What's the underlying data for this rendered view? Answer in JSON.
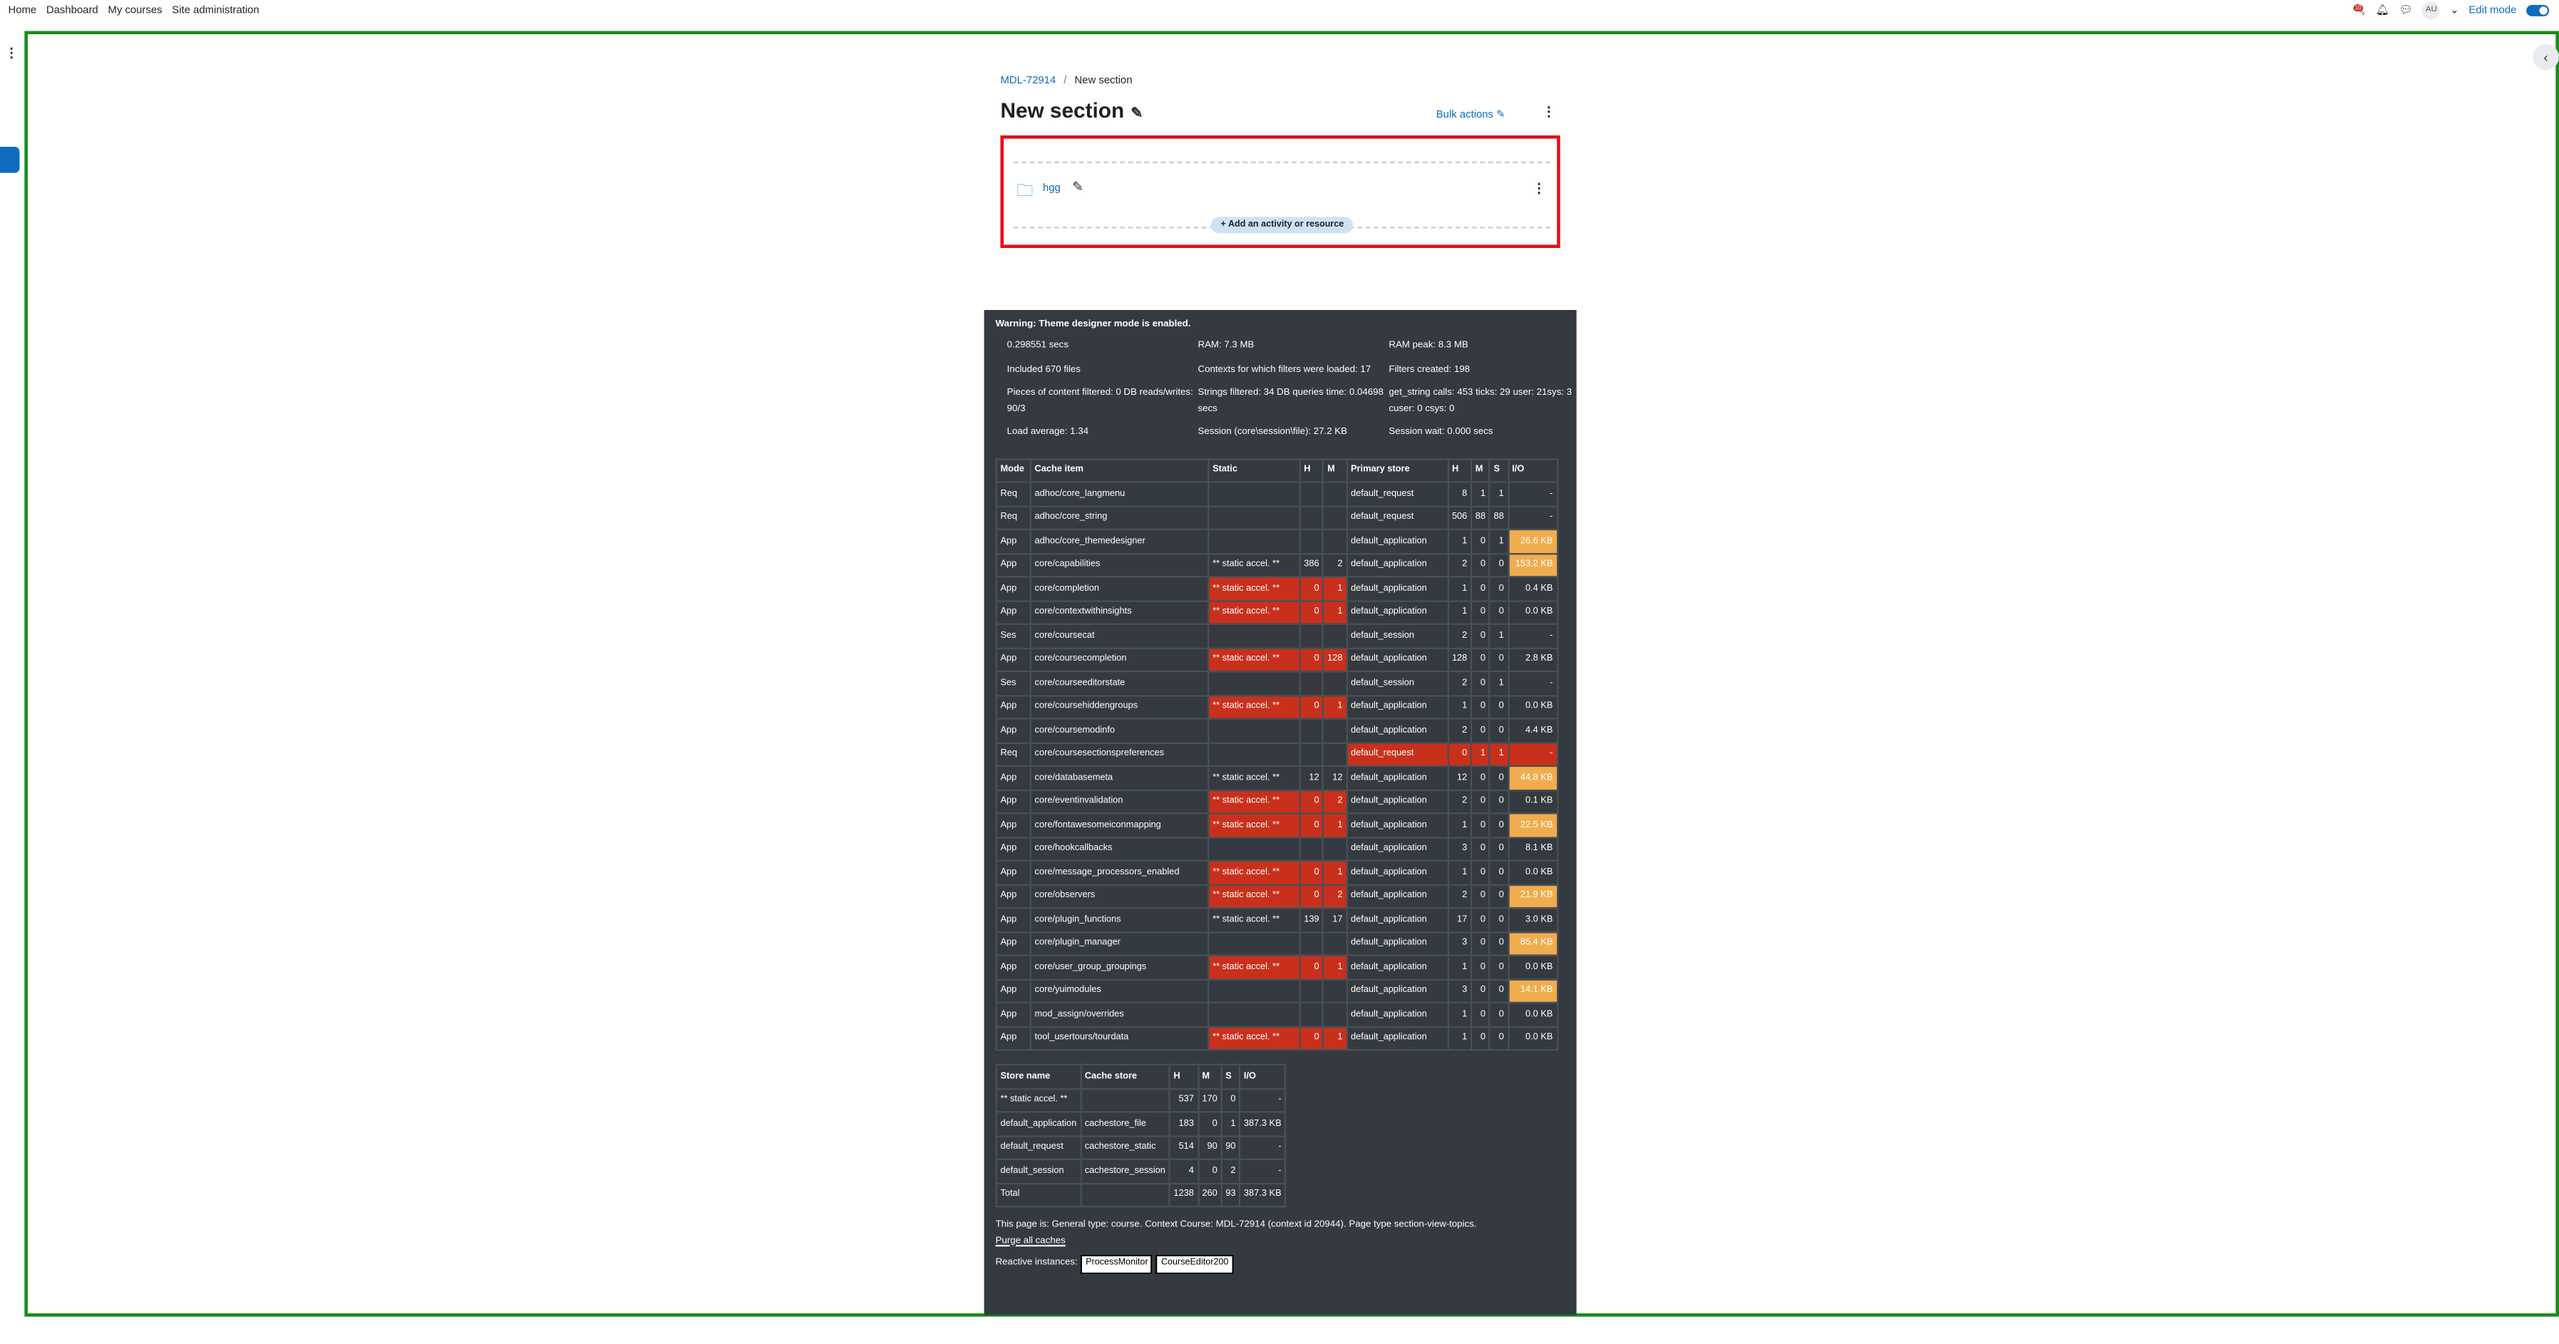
{
  "topnav": {
    "items": [
      "Home",
      "Dashboard",
      "My courses",
      "Site administration"
    ],
    "badge": "10",
    "avatar": "AU",
    "edit_mode": "Edit mode"
  },
  "breadcrumb": {
    "course": "MDL-72914",
    "sep": "/",
    "current": "New section"
  },
  "page": {
    "title": "New section",
    "bulk": "Bulk actions"
  },
  "activity": {
    "name": "hgg",
    "add": "Add an activity or resource"
  },
  "perf": {
    "warning": "Warning: Theme designer mode is enabled.",
    "stats": [
      "0.298551 secs",
      "RAM: 7.3 MB",
      "RAM peak: 8.3 MB",
      "Included 670 files",
      "Contexts for which filters were loaded: 17",
      "Filters created: 198",
      "Pieces of content filtered: 0 DB reads/writes: 90/3",
      "Strings filtered: 34 DB queries time: 0.04698 secs",
      "get_string calls: 453 ticks: 29 user: 21sys: 3 cuser: 0 csys: 0",
      "Load average: 1.34",
      "Session (core\\session\\file): 27.2 KB",
      "Session wait: 0.000 secs"
    ],
    "cache_headers": [
      "Mode",
      "Cache item",
      "Static",
      "H",
      "M",
      "Primary store",
      "H",
      "M",
      "S",
      "I/O"
    ],
    "cache_rows": [
      [
        "Req",
        "adhoc/core_langmenu",
        "",
        "",
        "",
        "default_request",
        "8",
        "1",
        "1",
        "-"
      ],
      [
        "Req",
        "adhoc/core_string",
        "",
        "",
        "",
        "default_request",
        "506",
        "88",
        "88",
        "-"
      ],
      [
        "App",
        "adhoc/core_themedesigner",
        "",
        "",
        "",
        "default_application",
        "1",
        "0",
        "1",
        "26.6 KB"
      ],
      [
        "App",
        "core/capabilities",
        "** static accel. **",
        "386",
        "2",
        "default_application",
        "2",
        "0",
        "0",
        "153.2 KB"
      ],
      [
        "App",
        "core/completion",
        "** static accel. **",
        "0",
        "1",
        "default_application",
        "1",
        "0",
        "0",
        "0.4 KB"
      ],
      [
        "App",
        "core/contextwithinsights",
        "** static accel. **",
        "0",
        "1",
        "default_application",
        "1",
        "0",
        "0",
        "0.0 KB"
      ],
      [
        "Ses",
        "core/coursecat",
        "",
        "",
        "",
        "default_session",
        "2",
        "0",
        "1",
        "-"
      ],
      [
        "App",
        "core/coursecompletion",
        "** static accel. **",
        "0",
        "128",
        "default_application",
        "128",
        "0",
        "0",
        "2.8 KB"
      ],
      [
        "Ses",
        "core/courseeditorstate",
        "",
        "",
        "",
        "default_session",
        "2",
        "0",
        "1",
        "-"
      ],
      [
        "App",
        "core/coursehiddengroups",
        "** static accel. **",
        "0",
        "1",
        "default_application",
        "1",
        "0",
        "0",
        "0.0 KB"
      ],
      [
        "App",
        "core/coursemodinfo",
        "",
        "",
        "",
        "default_application",
        "2",
        "0",
        "0",
        "4.4 KB"
      ],
      [
        "Req",
        "core/coursesectionspreferences",
        "",
        "",
        "",
        "default_request",
        "0",
        "1",
        "1",
        "-"
      ],
      [
        "App",
        "core/databasemeta",
        "** static accel. **",
        "12",
        "12",
        "default_application",
        "12",
        "0",
        "0",
        "44.8 KB"
      ],
      [
        "App",
        "core/eventinvalidation",
        "** static accel. **",
        "0",
        "2",
        "default_application",
        "2",
        "0",
        "0",
        "0.1 KB"
      ],
      [
        "App",
        "core/fontawesomeiconmapping",
        "** static accel. **",
        "0",
        "1",
        "default_application",
        "1",
        "0",
        "0",
        "22.5 KB"
      ],
      [
        "App",
        "core/hookcallbacks",
        "",
        "",
        "",
        "default_application",
        "3",
        "0",
        "0",
        "8.1 KB"
      ],
      [
        "App",
        "core/message_processors_enabled",
        "** static accel. **",
        "0",
        "1",
        "default_application",
        "1",
        "0",
        "0",
        "0.0 KB"
      ],
      [
        "App",
        "core/observers",
        "** static accel. **",
        "0",
        "2",
        "default_application",
        "2",
        "0",
        "0",
        "21.9 KB"
      ],
      [
        "App",
        "core/plugin_functions",
        "** static accel. **",
        "139",
        "17",
        "default_application",
        "17",
        "0",
        "0",
        "3.0 KB"
      ],
      [
        "App",
        "core/plugin_manager",
        "",
        "",
        "",
        "default_application",
        "3",
        "0",
        "0",
        "85.4 KB"
      ],
      [
        "App",
        "core/user_group_groupings",
        "** static accel. **",
        "0",
        "1",
        "default_application",
        "1",
        "0",
        "0",
        "0.0 KB"
      ],
      [
        "App",
        "core/yuimodules",
        "",
        "",
        "",
        "default_application",
        "3",
        "0",
        "0",
        "14.1 KB"
      ],
      [
        "App",
        "mod_assign/overrides",
        "",
        "",
        "",
        "default_application",
        "1",
        "0",
        "0",
        "0.0 KB"
      ],
      [
        "App",
        "tool_usertours/tourdata",
        "** static accel. **",
        "0",
        "1",
        "default_application",
        "1",
        "0",
        "0",
        "0.0 KB"
      ]
    ],
    "store_headers": [
      "Store name",
      "Cache store",
      "H",
      "M",
      "S",
      "I/O"
    ],
    "store_rows": [
      [
        "** static accel. **",
        "",
        "537",
        "170",
        "0",
        "-"
      ],
      [
        "default_application",
        "cachestore_file",
        "183",
        "0",
        "1",
        "387.3 KB"
      ],
      [
        "default_request",
        "cachestore_static",
        "514",
        "90",
        "90",
        "-"
      ],
      [
        "default_session",
        "cachestore_session",
        "4",
        "0",
        "2",
        "-"
      ],
      [
        "Total",
        "",
        "1238",
        "260",
        "93",
        "387.3 KB"
      ]
    ],
    "page_info": "This page is: General type: course. Context Course: MDL-72914 (context id 20944). Page type section-view-topics.",
    "purge": "Purge all caches",
    "reactive_label": "Reactive instances:",
    "reactive": [
      "ProcessMonitor",
      "CourseEditor200"
    ]
  }
}
